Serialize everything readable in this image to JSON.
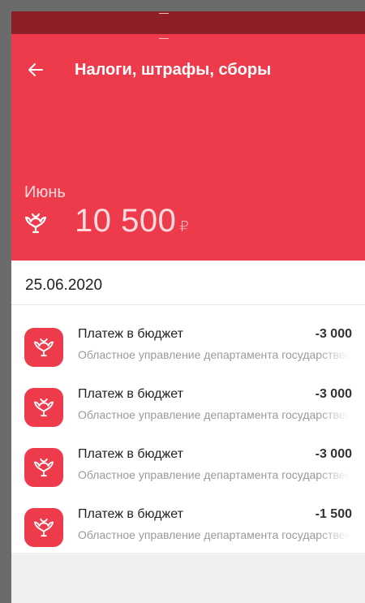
{
  "header": {
    "title": "Налоги, штрафы, сборы",
    "month": "Июнь",
    "total_amount": "10 500",
    "currency": "₽"
  },
  "date_group": "25.06.2020",
  "transactions": [
    {
      "title": "Платеж в бюджет",
      "amount": "-3 000",
      "description": "Областное управление департамента государственного"
    },
    {
      "title": "Платеж в бюджет",
      "amount": "-3 000",
      "description": "Областное управление департамента государственного"
    },
    {
      "title": "Платеж в бюджет",
      "amount": "-3 000",
      "description": "Областное управление департамента государственного"
    },
    {
      "title": "Платеж в бюджет",
      "amount": "-1 500",
      "description": "Областное управление департамента государственного"
    }
  ],
  "colors": {
    "brand": "#ee3b4c",
    "status_bar": "#8e1f27"
  },
  "icons": {
    "back": "arrow-left-icon",
    "emblem": "coat-of-arms-icon"
  }
}
